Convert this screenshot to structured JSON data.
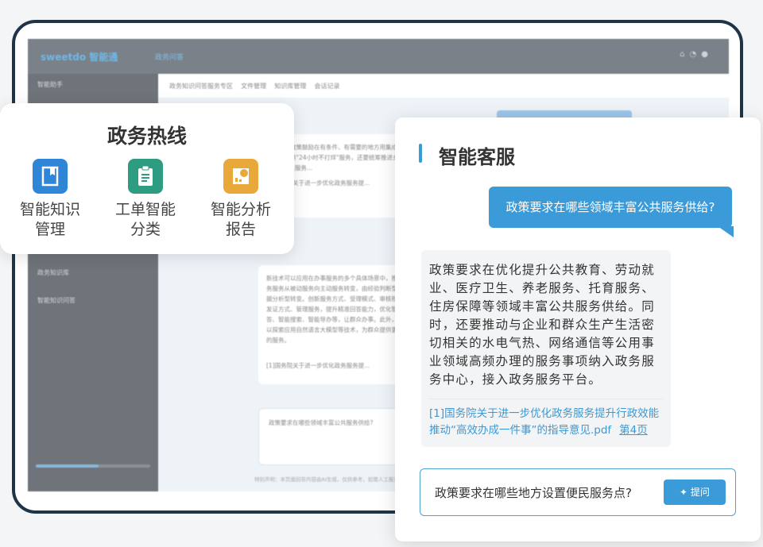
{
  "background_app": {
    "logo": "sweetdo 智能通",
    "top_nav": "政务问答",
    "sidebar_items": [
      "智能助手",
      "政务知识库",
      "智能知识问答"
    ],
    "tabs": [
      "政务知识问答服务专区",
      "文件管理",
      "知识库管理",
      "会话记录"
    ],
    "card1_text": "的文档。政策鼓励在有条件、有需要的地方用集成式自助终端提供\"24小时不打烊\"服务，还要统筹推进乡镇(街道)便民服务...",
    "card1_ref": "[1]国务院关于进一步优化政务服务提...",
    "card2_text": "新技术可以应用在办事服务的多个具体场景中，推动政务服务从被动服务向主动服务转变，由经验判断型向数据分析型转变。创新服务方式、受理模式、审核程序、发证方式、管理服务，提升精准回答能力，优化智能问答、智能搜索、智能导办等，让群众办事。此外，还可以探索应用自然语言大模型等技术，为群众提供更优质的服务。",
    "card2_ref": "[1]国务院关于进一步优化政务服务提...",
    "input_value": "政策要求在哪些领域丰富公共服务供给?",
    "footer": "特别声明：本页面回答内容由AI生成，仅供参考，如需人工服务请拨打热线"
  },
  "hotline_card": {
    "title": "政务热线",
    "features": [
      {
        "icon": "book-icon",
        "label_1": "智能知识",
        "label_2": "管理",
        "color": "#2f86d6"
      },
      {
        "icon": "clipboard-icon",
        "label_1": "工单智能",
        "label_2": "分类",
        "color": "#2e9c80"
      },
      {
        "icon": "chart-report-icon",
        "label_1": "智能分析",
        "label_2": "报告",
        "color": "#e8a93a"
      }
    ]
  },
  "service_card": {
    "title": "智能客服",
    "user_question": "政策要求在哪些领域丰富公共服务供给?",
    "answer": "政策要求在优化提升公共教育、劳动就业、医疗卫生、养老服务、托育服务、住房保障等领域丰富公共服务供给。同时，还要推动与企业和群众生产生活密切相关的水电气热、网络通信等公用事业领域高频办理的服务事项纳入政务服务中心，接入政务服务平台。",
    "reference": "[1]国务院关于进一步优化政务服务提升行政效能推动“高效办成一件事”的指导意见.pdf",
    "reference_page": "第4页",
    "input_value": "政策要求在哪些地方设置便民服务点?",
    "ask_button": "提问",
    "accent": "#3b9bd8"
  }
}
